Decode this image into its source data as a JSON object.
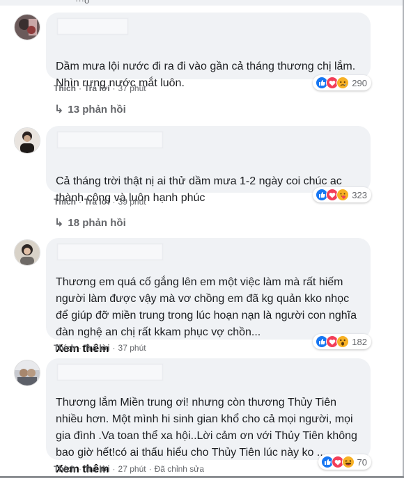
{
  "header_cut": "···o",
  "comments": [
    {
      "text": "Dầm mưa lội nước đi ra đi vào gần cả tháng thương chị lắm. Nhìn rưng nước mắt luôn.",
      "see_more": "",
      "like": "Thích",
      "reply": "Trả lời",
      "time": "37 phút",
      "edited": "",
      "reaction_icons": [
        "like-icon",
        "love-icon",
        "sad-icon"
      ],
      "reaction_count": "290",
      "replies": "13 phản hồi"
    },
    {
      "text": "Cả tháng trời thật nị ai thử dầm mưa 1-2 ngày coi chúc ac thành công và luôn hạnh phúc",
      "see_more": "",
      "like": "Thích",
      "reply": "Trả lời",
      "time": "39 phút",
      "edited": "",
      "reaction_icons": [
        "like-icon",
        "love-icon",
        "care-icon"
      ],
      "reaction_count": "323",
      "replies": "18 phản hồi"
    },
    {
      "text": "Thương em quá cố gắng lên em một việc làm mà rất hiếm người làm được vậy mà vơ chồng em đã kg quản kko nhọc để giúp đỡ miền trung trong lúc hoạn nạn là người con nghĩa đàn nghệ an chị rất kkam phục vợ chồn...",
      "see_more": "Xem thêm",
      "like": "Thích",
      "reply": "Trả lời",
      "time": "37 phút",
      "edited": "",
      "reaction_icons": [
        "like-icon",
        "love-icon",
        "wow-icon"
      ],
      "reaction_count": "182",
      "replies": ""
    },
    {
      "text": "Thương lắm Miền trung ơi! nhưng còn thương Thủy Tiên nhiều hơn. Một mình hi sinh gian khổ cho cả mọi người, mọi gia đình .Va toan thể xa hội..Lời cảm ơn với Thủy Tiên không bao giờ hết!có ai thấu hiểu cho Thủy Tiên lúc này ko ...",
      "see_more": "Xem thêm",
      "like": "Thích",
      "reply": "Trả lời",
      "time": "27 phút",
      "edited": "Đã chỉnh sửa",
      "reaction_icons": [
        "like-icon",
        "love-icon",
        "haha-icon"
      ],
      "reaction_count": "70",
      "replies": ""
    }
  ]
}
